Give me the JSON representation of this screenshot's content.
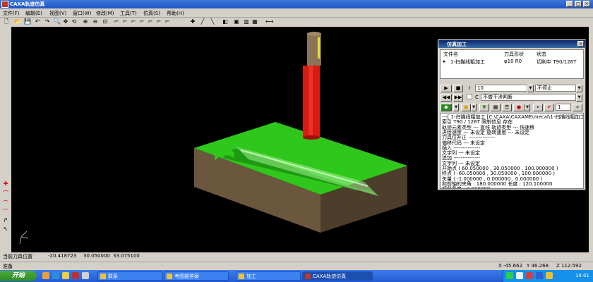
{
  "window": {
    "title": "CAXA轨迹仿真",
    "min": "_",
    "max": "□",
    "close": "×"
  },
  "menu": [
    "文件(F)",
    "编辑(E)",
    "视图(V)",
    "窗口(W)",
    "修改(M)",
    "工具(T)",
    "仿真(S)",
    "帮助(H)"
  ],
  "toolbar_icons": [
    "new-icon",
    "open-icon",
    "save-icon",
    "undo-icon",
    "redo-icon",
    "zoom-icon",
    "pan-icon",
    "rotate-icon",
    "zoom-in-icon",
    "zoom-out-icon",
    "zoom-fit-icon",
    "view-icon",
    "view-icon",
    "view-icon",
    "view-icon",
    "view-icon",
    "view-icon",
    "view-icon",
    "move-icon",
    "axis-icon",
    "line-icon",
    "cube-icon",
    "box-icon",
    "pipe-icon",
    "flag-icon",
    "gauge-icon"
  ],
  "toolbar_glyphs": [
    "🗋",
    "📂",
    "💾",
    "↶",
    "↷",
    "🔍",
    "✥",
    "⟲",
    "⊕",
    "⊖",
    "⊡",
    "⌐",
    "⌐",
    "⌐",
    "⌐",
    "⌐",
    "⌐",
    "⌐",
    "✚",
    "╱",
    "╲",
    "◧",
    "▣",
    "▥",
    "▦",
    "⟷"
  ],
  "left_tools": [
    "✚",
    "⌒",
    "⌒",
    "⌒",
    "↱",
    "↖"
  ],
  "status": {
    "label": "当前刀具位置",
    "x": "-20.418723",
    "y": "30.050000",
    "z": "33.075100"
  },
  "hint": "准备",
  "coords": {
    "x": "X -45.662",
    "y": "Y 46.268",
    "z": "Z 112.592"
  },
  "taskbar": {
    "start": "开始",
    "tasks": [
      "联系",
      "考图题答案",
      "加工",
      "CAXA轨迹仿真"
    ],
    "clock": "14:01"
  },
  "dialog": {
    "title": "仿真加工",
    "col_file": "文件名",
    "col_tool": "刀具形状",
    "col_state": "状态",
    "row_name": "1-扫描线粗加工",
    "row_tool": "φ10 R0",
    "row_state": "切削中 T90/126T",
    "step_label": "I",
    "step_value": "10",
    "stop_value": "不停止",
    "check_label": "C",
    "check_value": "不做干涉判断",
    "page_value": "1",
    "info": [
      "---[ 1-扫描线粗加工 [C:\\CAXA\\CAXAME\\mecal\\1-扫描线粗加工]",
      "索引     T90 / 126T        限制信息   存在",
      "轨迹元素类型  ---  直线      轨迹类型  ---  快速移",
      "进给速度  ---  未设定      旋转速度  ---  未设定",
      "刀具位补正 ---------------",
      "       偏移代码  ---  未设定",
      "插入  ---------------",
      "       文字列  ---  未设定",
      "追加  ---------------",
      "       文字列  ---  未设定",
      "开始点      ( 60.050000 , 30.050000 , 100.000000 )",
      "终点       ( -60.050000 , 30.050000 , 100.000000 )",
      "矢量      ( -1.000000 , 0.000000 , 0.000000 )",
      "和前轴的夹角 : 180.000000  长度 : 120.100000",
      "倾斜角度  : 0.000000"
    ]
  },
  "colors": {
    "stock_top": "#2fc71b",
    "stock_side": "#5e4b36",
    "tool_body": "#d81b12",
    "tool_holder": "#8a7456",
    "background": "#000000"
  }
}
